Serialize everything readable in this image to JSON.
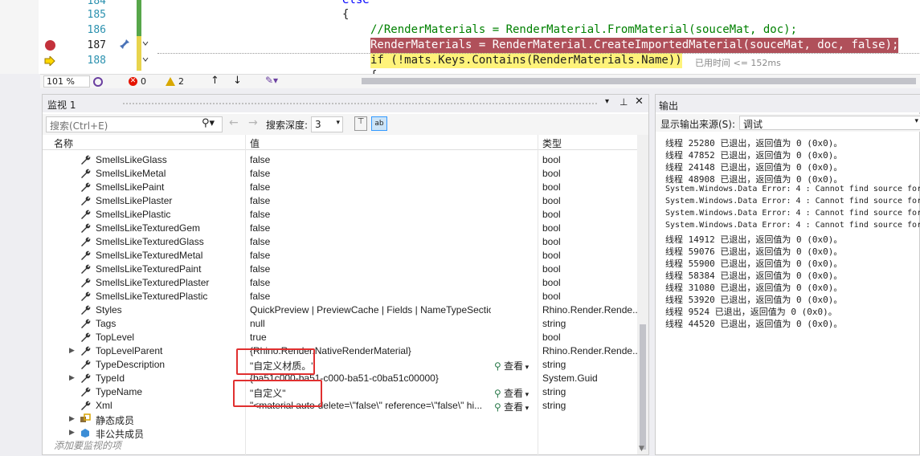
{
  "editor": {
    "lines": [
      {
        "num": "184",
        "code": "else"
      },
      {
        "num": "185",
        "code": "{"
      },
      {
        "num": "186",
        "code": "//RenderMaterials = RenderMaterial.FromMaterial(souceMat, doc);"
      },
      {
        "num": "187",
        "code": "RenderMaterials = RenderMaterial.CreateImportedMaterial(souceMat, doc, false);"
      },
      {
        "num": "188",
        "code": "if (!mats.Keys.Contains(RenderMaterials.Name))"
      },
      {
        "num": "",
        "code": "{"
      }
    ],
    "elapsed": "已用时间 <= 152ms",
    "zoom": "101 %",
    "errors": "0",
    "warnings": "2"
  },
  "watch": {
    "title": "监视 1",
    "search_placeholder": "搜索(Ctrl+E)",
    "depth_label": "搜索深度:",
    "depth_value": "3",
    "col_name": "名称",
    "col_value": "值",
    "col_type": "类型",
    "view_label": "查看",
    "add_watch": "添加要监视的项",
    "rows": [
      {
        "name": "SmellsLikeGlass",
        "value": "false",
        "type": "bool"
      },
      {
        "name": "SmellsLikeMetal",
        "value": "false",
        "type": "bool"
      },
      {
        "name": "SmellsLikePaint",
        "value": "false",
        "type": "bool"
      },
      {
        "name": "SmellsLikePlaster",
        "value": "false",
        "type": "bool"
      },
      {
        "name": "SmellsLikePlastic",
        "value": "false",
        "type": "bool"
      },
      {
        "name": "SmellsLikeTexturedGem",
        "value": "false",
        "type": "bool"
      },
      {
        "name": "SmellsLikeTexturedGlass",
        "value": "false",
        "type": "bool"
      },
      {
        "name": "SmellsLikeTexturedMetal",
        "value": "false",
        "type": "bool"
      },
      {
        "name": "SmellsLikeTexturedPaint",
        "value": "false",
        "type": "bool"
      },
      {
        "name": "SmellsLikeTexturedPlaster",
        "value": "false",
        "type": "bool"
      },
      {
        "name": "SmellsLikeTexturedPlastic",
        "value": "false",
        "type": "bool"
      },
      {
        "name": "Styles",
        "value": "QuickPreview | PreviewCache | Fields | NameTypeSection",
        "type": "Rhino.Render.Rende..."
      },
      {
        "name": "Tags",
        "value": "null",
        "type": "string"
      },
      {
        "name": "TopLevel",
        "value": "true",
        "type": "bool"
      },
      {
        "name": "TopLevelParent",
        "value": "{Rhino.Render.NativeRenderMaterial}",
        "type": "Rhino.Render.Rende..."
      },
      {
        "name": "TypeDescription",
        "value": "\"自定义材质。\"",
        "type": "string"
      },
      {
        "name": "TypeId",
        "value": "{ba51c000-ba51-c000-ba51-c0ba51c00000}",
        "type": "System.Guid"
      },
      {
        "name": "TypeName",
        "value": "\"自定义\"",
        "type": "string"
      },
      {
        "name": "Xml",
        "value": "\"<material auto-delete=\\\"false\\\" reference=\\\"false\\\" hi...",
        "type": "string"
      },
      {
        "name": "静态成员",
        "value": "",
        "type": ""
      },
      {
        "name": "非公共成员",
        "value": "",
        "type": ""
      }
    ]
  },
  "output": {
    "title": "输出",
    "source_label": "显示输出来源(S):",
    "source_value": "调试",
    "lines": [
      "线程 25280 已退出，返回值为 0 (0x0)。",
      "线程 47852 已退出，返回值为 0 (0x0)。",
      "线程 24148 已退出，返回值为 0 (0x0)。",
      "线程 48908 已退出，返回值为 0 (0x0)。",
      "System.Windows.Data Error: 4 : Cannot find source for",
      "System.Windows.Data Error: 4 : Cannot find source for",
      "System.Windows.Data Error: 4 : Cannot find source for",
      "System.Windows.Data Error: 4 : Cannot find source for",
      "线程 14912 已退出，返回值为 0 (0x0)。",
      "线程 59076 已退出，返回值为 0 (0x0)。",
      "线程 55900 已退出，返回值为 0 (0x0)。",
      "线程 58384 已退出，返回值为 0 (0x0)。",
      "线程 31080 已退出，返回值为 0 (0x0)。",
      "线程 53920 已退出，返回值为 0 (0x0)。",
      "线程 9524 已退出，返回值为 0 (0x0)。",
      "线程 44520 已退出，返回值为 0 (0x0)。"
    ]
  },
  "colors": {
    "breakpoint": "#c3313b",
    "highlight_red": "#b0505a",
    "highlight_yellow": "#fff37a",
    "annotation_box": "#e03030"
  }
}
